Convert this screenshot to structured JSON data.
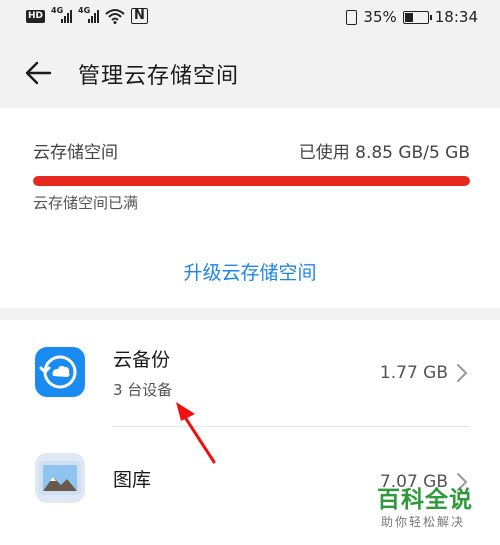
{
  "status_bar": {
    "left_badge": "HD",
    "network_1": "4G",
    "network_2": "4G",
    "battery_percent": "35%",
    "time": "18:34",
    "battery_level": 0.35
  },
  "header": {
    "title": "管理云存储空间",
    "back_icon": "arrow-left-icon"
  },
  "storage": {
    "label": "云存储空间",
    "used_text": "已使用 8.85 GB/5 GB",
    "progress_fraction": 1.0,
    "progress_color": "#e8281e",
    "full_note": "云存储空间已满",
    "upgrade_label": "升级云存储空间",
    "upgrade_color": "#1e86e8"
  },
  "items": [
    {
      "title": "云备份",
      "subtitle": "3 台设备",
      "size": "1.77 GB",
      "icon": "cloud-backup-icon"
    },
    {
      "title": "图库",
      "size": "7.07 GB",
      "icon": "gallery-icon"
    }
  ],
  "watermark": {
    "main": "百科全说",
    "sub": "助你轻松解决"
  }
}
